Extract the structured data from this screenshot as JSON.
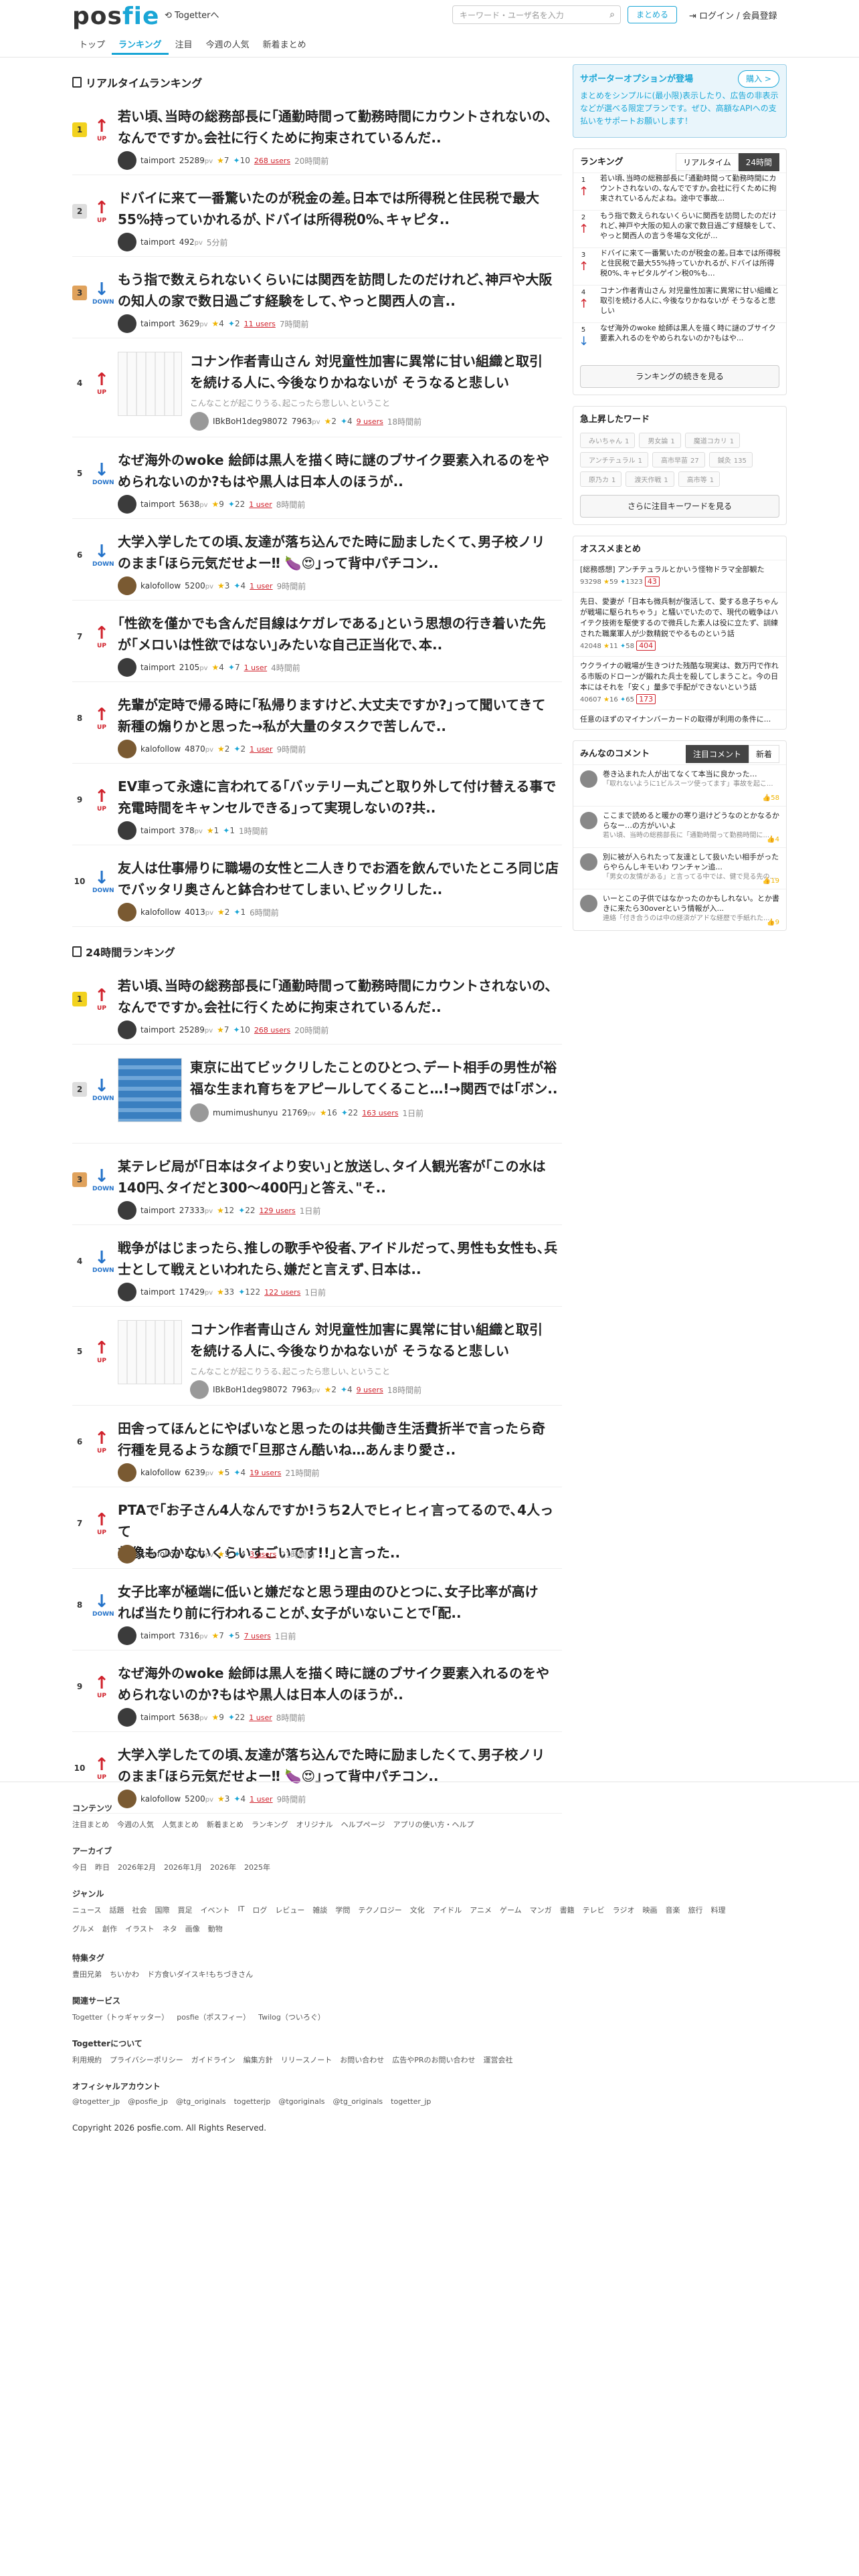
{
  "header": {
    "logo": "posfie",
    "togetter_link": "Togetterへ",
    "search_placeholder": "キーワード・ユーザ名を入力",
    "matome_button": "まとめる",
    "login": "ログイン / 会員登録",
    "nav": [
      "トップ",
      "ランキング",
      "注目",
      "今週の人気",
      "新着まとめ"
    ]
  },
  "realtime": {
    "title": "リアルタイムランキング",
    "items": [
      {
        "rank": "1",
        "dir": "up",
        "dir_label": "UP",
        "title_l1": "若い頃､当時の総務部長に｢通勤時間って勤務時間にカウントされないの､",
        "title_l2": "なんでですか｡会社に行くために拘束されているんだ..",
        "user": "taimport",
        "pv": "25289",
        "pv_unit": "pv",
        "stars": "7",
        "tweets": "10",
        "users": "268 users",
        "ago": "20時間前"
      },
      {
        "rank": "2",
        "dir": "up",
        "dir_label": "UP",
        "title_l1": "ドバイに来て一番驚いたのが税金の差｡日本では所得税と住民税で最大",
        "title_l2": "55%持っていかれるが､ドバイは所得税0%､キャピタ..",
        "user": "taimport",
        "pv": "492",
        "pv_unit": "pv",
        "stars": "",
        "tweets": "",
        "users": "",
        "ago": "5分前"
      },
      {
        "rank": "3",
        "dir": "down",
        "dir_label": "DOWN",
        "title_l1": "もう指で数えられないくらいには関西を訪問したのだけれど､神戸や大阪",
        "title_l2": "の知人の家で数日過ごす経験をして､やっと関西人の言..",
        "user": "taimport",
        "pv": "3629",
        "pv_unit": "pv",
        "stars": "4",
        "tweets": "2",
        "users": "11 users",
        "ago": "7時間前"
      },
      {
        "rank": "4",
        "dir": "up",
        "dir_label": "UP",
        "title_l1": "コナン作者青山さん 対児童性加害に異常に甘い組織と取引",
        "title_l2": "を続ける人に､今後なりかねないが そうなると悲しい",
        "desc": "こんなことが起こりうる､起こったら悲しい､ということ",
        "user": "IBkBoH1deg98072",
        "pv": "7963",
        "pv_unit": "pv",
        "stars": "2",
        "tweets": "4",
        "users": "9 users",
        "ago": "18時間前"
      },
      {
        "rank": "5",
        "dir": "down",
        "dir_label": "DOWN",
        "title_l1": "なぜ海外のwoke 絵師は黒人を描く時に謎のブサイク要素入れるのをや",
        "title_l2": "められないのか?もはや黒人は日本人のほうが..",
        "user": "taimport",
        "pv": "5638",
        "pv_unit": "pv",
        "stars": "9",
        "tweets": "22",
        "users": "1 user",
        "ago": "8時間前"
      },
      {
        "rank": "6",
        "dir": "down",
        "dir_label": "DOWN",
        "title_l1": "大学入学したての頃､友達が落ち込んでた時に励ましたくて､男子校ノリ",
        "title_l2": "のまま｢ほら元気だせよー‼ 🍆😍｣って背中パチコン..",
        "user": "kalofollow",
        "pv": "5200",
        "pv_unit": "pv",
        "stars": "3",
        "tweets": "4",
        "users": "1 user",
        "ago": "9時間前"
      },
      {
        "rank": "7",
        "dir": "up",
        "dir_label": "UP",
        "title_l1": "｢性欲を僅かでも含んだ目線はケガレである｣という思想の行き着いた先",
        "title_l2": "が｢メロいは性欲ではない｣みたいな自己正当化で､本..",
        "user": "taimport",
        "pv": "2105",
        "pv_unit": "pv",
        "stars": "4",
        "tweets": "7",
        "users": "1 user",
        "ago": "4時間前"
      },
      {
        "rank": "8",
        "dir": "up",
        "dir_label": "UP",
        "title_l1": "先輩が定時で帰る時に｢私帰りますけど､大丈夫ですか?｣って聞いてきて",
        "title_l2": "新種の煽りかと思った→私が大量のタスクで苦しんで..",
        "user": "kalofollow",
        "pv": "4870",
        "pv_unit": "pv",
        "stars": "2",
        "tweets": "2",
        "users": "1 user",
        "ago": "9時間前"
      },
      {
        "rank": "9",
        "dir": "up",
        "dir_label": "UP",
        "title_l1": "EV車って永遠に言われてる｢バッテリー丸ごと取り外して付け替える事で",
        "title_l2": "充電時間をキャンセルできる｣って実現しないの?共..",
        "user": "taimport",
        "pv": "378",
        "pv_unit": "pv",
        "stars": "1",
        "tweets": "1",
        "users": "",
        "ago": "1時間前"
      },
      {
        "rank": "10",
        "dir": "down",
        "dir_label": "DOWN",
        "title_l1": "友人は仕事帰りに職場の女性と二人きりでお酒を飲んでいたところ同じ店",
        "title_l2": "でバッタリ奥さんと鉢合わせてしまい､ビックリした..",
        "user": "kalofollow",
        "pv": "4013",
        "pv_unit": "pv",
        "stars": "2",
        "tweets": "1",
        "users": "",
        "ago": "6時間前"
      }
    ]
  },
  "daily": {
    "title": "24時間ランキング",
    "items": [
      {
        "rank": "1",
        "dir": "up",
        "dir_label": "UP",
        "title_l1": "若い頃､当時の総務部長に｢通勤時間って勤務時間にカウントされないの､",
        "title_l2": "なんでですか｡会社に行くために拘束されているんだ..",
        "user": "taimport",
        "pv": "25289",
        "pv_unit": "pv",
        "stars": "7",
        "tweets": "10",
        "users": "268 users",
        "ago": "20時間前"
      },
      {
        "rank": "2",
        "dir": "down",
        "dir_label": "DOWN",
        "title_l1": "東京に出てビックリしたことのひとつ､デート相手の男性が裕",
        "title_l2": "福な生まれ育ちをアピールしてくること…!→関西では｢ボン..",
        "user": "mumimushunyu",
        "pv": "21769",
        "pv_unit": "pv",
        "stars": "16",
        "tweets": "22",
        "users": "163 users",
        "ago": "1日前"
      },
      {
        "rank": "3",
        "dir": "down",
        "dir_label": "DOWN",
        "title_l1": "某テレビ局が｢日本はタイより安い｣と放送し､タイ人観光客が｢この水は",
        "title_l2": "140円､タイだと300～400円｣と答え､\"そ..",
        "user": "taimport",
        "pv": "27333",
        "pv_unit": "pv",
        "stars": "12",
        "tweets": "22",
        "users": "129 users",
        "ago": "1日前"
      },
      {
        "rank": "4",
        "dir": "down",
        "dir_label": "DOWN",
        "title_l1": "戦争がはじまったら､推しの歌手や役者､アイドルだって､男性も女性も､兵",
        "title_l2": "士として戦えといわれたら､嫌だと言えず､日本は..",
        "user": "taimport",
        "pv": "17429",
        "pv_unit": "pv",
        "stars": "33",
        "tweets": "122",
        "users": "122 users",
        "ago": "1日前"
      },
      {
        "rank": "5",
        "dir": "up",
        "dir_label": "UP",
        "title_l1": "コナン作者青山さん 対児童性加害に異常に甘い組織と取引",
        "title_l2": "を続ける人に､今後なりかねないが そうなると悲しい",
        "desc": "こんなことが起こりうる､起こったら悲しい､ということ",
        "user": "IBkBoH1deg98072",
        "pv": "7963",
        "pv_unit": "pv",
        "stars": "2",
        "tweets": "4",
        "users": "9 users",
        "ago": "18時間前"
      },
      {
        "rank": "6",
        "dir": "up",
        "dir_label": "UP",
        "title_l1": "田舎ってほんとにやばいなと思ったのは共働き生活費折半で言ったら奇",
        "title_l2": "行種を見るような顔で｢旦那さん酷いね…あんまり愛さ..",
        "user": "kalofollow",
        "pv": "6239",
        "pv_unit": "pv",
        "stars": "5",
        "tweets": "4",
        "users": "19 users",
        "ago": "21時間前"
      },
      {
        "rank": "7",
        "dir": "up",
        "dir_label": "UP",
        "title_l1": "PTAで｢お子さん4人なんですか!うち2人でヒィヒィ言ってるので､4人って",
        "title_l2": "想像もつかないくらいすごいです!!｣と言った..",
        "user": "kalofollow",
        "pv": "5777",
        "pv_unit": "pv",
        "stars": "5",
        "tweets": "4",
        "users": "3 users",
        "ago": "21時間前"
      },
      {
        "rank": "8",
        "dir": "down",
        "dir_label": "DOWN",
        "title_l1": "女子比率が極端に低いと嫌だなと思う理由のひとつに､女子比率が高け",
        "title_l2": "れば当たり前に行われることが､女子がいないことで｢配..",
        "user": "taimport",
        "pv": "7316",
        "pv_unit": "pv",
        "stars": "7",
        "tweets": "5",
        "users": "7 users",
        "ago": "1日前"
      },
      {
        "rank": "9",
        "dir": "up",
        "dir_label": "UP",
        "title_l1": "なぜ海外のwoke 絵師は黒人を描く時に謎のブサイク要素入れるのをや",
        "title_l2": "められないのか?もはや黒人は日本人のほうが..",
        "user": "taimport",
        "pv": "5638",
        "pv_unit": "pv",
        "stars": "9",
        "tweets": "22",
        "users": "1 user",
        "ago": "8時間前"
      },
      {
        "rank": "10",
        "dir": "up",
        "dir_label": "UP",
        "title_l1": "大学入学したての頃､友達が落ち込んでた時に励ましたくて､男子校ノリ",
        "title_l2": "のまま｢ほら元気だせよー‼ 🍆😍｣って背中パチコン..",
        "user": "kalofollow",
        "pv": "5200",
        "pv_unit": "pv",
        "stars": "3",
        "tweets": "4",
        "users": "1 user",
        "ago": "9時間前"
      }
    ]
  },
  "sidebar": {
    "supporter_title": "サポーターオプションが登場",
    "supporter_desc": "まとめをシンプルに(最小限)表示したり、広告の非表示などが選べる限定プランです。ぜひ、高額なAPIへの支払いをサポートお願いします！",
    "buy_button": "購入 >",
    "ranking_title": "ランキング",
    "ranking_tab_realtime": "リアルタイム",
    "ranking_tab_24h": "24時間",
    "ranking_items": [
      {
        "num": "1",
        "dir": "up",
        "text": "若い頃､当時の総務部長に｢通勤時間って勤務時間にカウントされないの､なんでですか｡会社に行くために拘束されているんだよね。途中で事故..."
      },
      {
        "num": "2",
        "dir": "up",
        "text": "もう指で数えられないくらいに関西を訪問したのだけれど､神戸や大阪の知人の家で数日過ごす経験をして､やっと関西人の言う冬場な文化が..."
      },
      {
        "num": "3",
        "dir": "up",
        "text": "ドバイに来て一番驚いたのが税金の差｡日本では所得税と住民税で最大55%持っていかれるが､ドバイは所得税0%､キャピタルゲイン税0%も..."
      },
      {
        "num": "4",
        "dir": "up",
        "text": "コナン作者青山さん 対児童性加害に異常に甘い組織と取引を続ける人に､今後なりかねないが そうなると悲しい"
      },
      {
        "num": "5",
        "dir": "down",
        "text": "なぜ海外のwoke 絵師は黒人を描く時に謎のブサイク要素入れるのをやめられないのか?もはや..."
      }
    ],
    "ranking_more": "ランキングの続きを見る",
    "keywords_title": "急上昇したワード",
    "keywords": [
      {
        "word": "みいちゃん",
        "count": "1"
      },
      {
        "word": "男女論",
        "count": "1"
      },
      {
        "word": "魔道コカリ",
        "count": "1"
      },
      {
        "word": "アンチテュラル",
        "count": "1"
      },
      {
        "word": "高市早苗",
        "count": "27"
      },
      {
        "word": "鍼灸",
        "count": "135"
      },
      {
        "word": "原乃カ",
        "count": "1"
      },
      {
        "word": "渡天作戦",
        "count": "1"
      },
      {
        "word": "高市等",
        "count": "1"
      }
    ],
    "keywords_more": "さらに注目キーワードを見る",
    "osusume_title": "オススメまとめ",
    "osusume": [
      {
        "text": "[総務感想] アンチテュラルとかいう怪物ドラマ全部観た",
        "pv": "93298",
        "stars": "59",
        "tweets": "1323",
        "users": "43"
      },
      {
        "text": "先日、愛妻が「日本も微兵制が復活して、愛する息子ちゃんが戦場に駆られちゃう」と騒いでいたので、現代の戦争はハイテク技術を駆使するので微兵した素人は役に立たず、訓練された職業軍人が少数精鋭でやるものという話",
        "pv": "42048",
        "stars": "11",
        "tweets": "58",
        "users": "404"
      },
      {
        "text": "ウクライナの戦場が生きつけた残酷な現実は、数万円で作れる市販のドローンが鍛れた兵士を殺してしまうこと。今の日本にはそれを「安く」量多で手配ができないという話",
        "pv": "40607",
        "stars": "16",
        "tweets": "65",
        "users": "173"
      },
      {
        "text": "任意のほずのマイナンバーカードの取得が利用の条件に..."
      }
    ],
    "comments_title": "みんなのコメント",
    "comments_tab_notice": "注目コメント",
    "comments_tab_new": "新着",
    "comments": [
      {
        "text": "巻き込まれた人が出てなくて本当に良かった…",
        "sub": "「取れないように1ビルスーツ使ってます」事故を起こ...",
        "likes": "58"
      },
      {
        "text": "ここまで読めると暖かの寒り退けどうなのとかなるからなー…の方がいいよ",
        "sub": "若い頃、当時の総務部長に「通勤時間って勤務時間に...",
        "likes": "4"
      },
      {
        "text": "別に被が入られたって友達として扱いたい相手がったらやらんしキモいわ ワンチャン追...",
        "sub": "「男女の友情がある」と言ってる中では、健で見る先の...",
        "likes": "19"
      },
      {
        "text": "いーとこの子供ではなかったのかもしれない。とか書きに来たら30overという情報が入...",
        "sub": "連絡「付き合うのは中の経済がアドな経歴で手紙れた...",
        "likes": "9"
      }
    ]
  },
  "footer": {
    "content_title": "コンテンツ",
    "content_links": [
      "注目まとめ",
      "今週の人気",
      "人気まとめ",
      "新着まとめ",
      "ランキング",
      "オリジナル",
      "ヘルプページ",
      "アプリの使い方・ヘルプ"
    ],
    "archive_title": "アーカイブ",
    "archive_links": [
      "今日",
      "昨日",
      "2026年2月",
      "2026年1月",
      "2026年",
      "2025年"
    ],
    "genre_title": "ジャンル",
    "genre_links": [
      "ニュース",
      "話題",
      "社会",
      "国際",
      "買足",
      "イベント",
      "IT",
      "ログ",
      "レビュー",
      "雑談",
      "学問",
      "テクノロジー",
      "文化",
      "アイドル",
      "アニメ",
      "ゲーム",
      "マンガ",
      "書籍",
      "テレビ",
      "ラジオ",
      "映画",
      "音楽",
      "旅行",
      "料理",
      "グルメ",
      "創作",
      "イラスト",
      "ネタ",
      "画像",
      "動物"
    ],
    "tag_title": "特集タグ",
    "tag_links": [
      "豊田兄弟",
      "ちいかわ",
      "ド方食いダイスキ!もちづきさん"
    ],
    "service_title": "関連サービス",
    "service_links": [
      "Togetter（トゥギャッター）",
      "posfie（ポスフィー）",
      "Twilog（ついろぐ）"
    ],
    "about_title": "Togetterについて",
    "about_links": [
      "利用規約",
      "プライバシーポリシー",
      "ガイドライン",
      "編集方針",
      "リリースノート",
      "お問い合わせ",
      "広告やPRのお問い合わせ",
      "運営会社"
    ],
    "official_title": "オフィシャルアカウント",
    "official_links": [
      "@togetter_jp",
      "@posfie_jp",
      "@tg_originals",
      "togetterjp",
      "@tgoriginals",
      "@tg_originals",
      "togetter_jp"
    ],
    "copyright": "Copyright 2026 posfie.com. All Rights Reserved."
  }
}
